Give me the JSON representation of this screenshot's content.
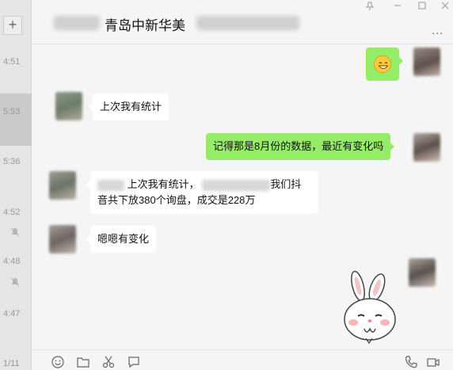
{
  "sidebar": {
    "add_label": "+",
    "rows": [
      {
        "time": "4:51"
      },
      {
        "time": "5:53"
      },
      {
        "time": "5:36"
      },
      {
        "time": "4:52"
      },
      {
        "time": "4:48"
      },
      {
        "time": "4:47"
      },
      {
        "time": "1/11"
      }
    ]
  },
  "header": {
    "title": "青岛中新华美",
    "more_label": "..."
  },
  "messages": [
    {
      "side": "out",
      "type": "emoji",
      "text": ""
    },
    {
      "side": "in",
      "type": "text",
      "text": "上次我有统计"
    },
    {
      "side": "out",
      "type": "text",
      "text": "记得那是8月份的数据，最近有变化吗"
    },
    {
      "side": "in",
      "type": "text",
      "line1_a": "上次我有统计，",
      "line1_b": "我们抖",
      "line2": "音共下放380个询盘，成交是228万"
    },
    {
      "side": "in",
      "type": "text",
      "text": "嗯嗯有变化"
    },
    {
      "side": "out",
      "type": "sticker",
      "text": ""
    }
  ],
  "colors": {
    "out_bubble": "#95ec69",
    "in_bubble": "#ffffff",
    "background": "#f5f5f5"
  },
  "toolbar": {
    "icons": [
      "emoji-icon",
      "folder-icon",
      "scissors-icon",
      "chat-history-icon",
      "phone-icon",
      "video-icon"
    ]
  }
}
